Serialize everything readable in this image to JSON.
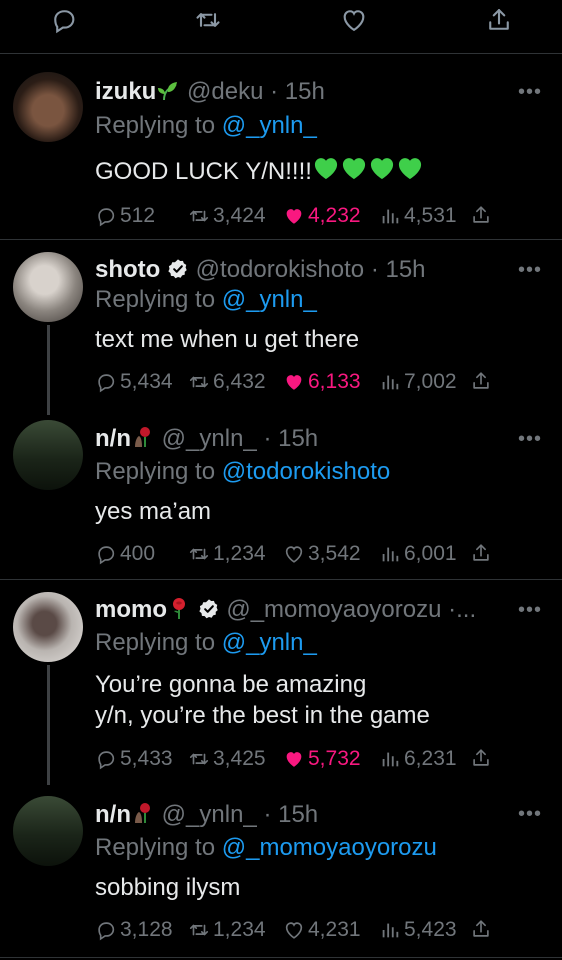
{
  "colors": {
    "background": "#000000",
    "text": "#e7e9ea",
    "muted": "#71767b",
    "link": "#1d9bf0",
    "like": "#f91880",
    "heart_emoji": "#3fcf4a",
    "rose": "#d5202e"
  },
  "top_actions": [
    "reply-icon",
    "retweet-icon",
    "like-icon",
    "share-icon"
  ],
  "tweets": [
    {
      "name": "izuku",
      "name_emoji": "seedling",
      "verified": false,
      "handle": "@deku",
      "time": "· 15h",
      "replying_prefix": "Replying to ",
      "replying_to": "@_ynln_",
      "text": "GOOD LUCK Y/N!!!!",
      "text_emoji": "green-hearts-x4",
      "replies": "512",
      "retweets": "3,424",
      "likes": "4,232",
      "liked": true,
      "views": "4,531"
    },
    {
      "name": "shoto",
      "verified": true,
      "handle": "@todorokishoto",
      "time": "· 15h",
      "replying_prefix": "Replying to ",
      "replying_to": "@_ynln_",
      "text": "text me when u get there",
      "replies": "5,434",
      "retweets": "6,432",
      "likes": "6,133",
      "liked": true,
      "views": "7,002"
    },
    {
      "name": "n/n",
      "name_emoji": "rose-figure",
      "verified": false,
      "handle": "@_ynln_",
      "time": "· 15h",
      "replying_prefix": "Replying to ",
      "replying_to": "@todorokishoto",
      "text": "yes ma’am",
      "replies": "400",
      "retweets": "1,234",
      "likes": "3,542",
      "liked": false,
      "views": "6,001"
    },
    {
      "name": "momo",
      "name_emoji": "rose",
      "verified": true,
      "handle": "@_momoyaoyorozu ·...",
      "time": "",
      "replying_prefix": "Replying to ",
      "replying_to": "@_ynln_",
      "text": "You’re gonna be amazing\ny/n, you’re the best in the game",
      "replies": "5,433",
      "retweets": "3,425",
      "likes": "5,732",
      "liked": true,
      "views": "6,231"
    },
    {
      "name": "n/n",
      "name_emoji": "rose-figure",
      "verified": false,
      "handle": "@_ynln_",
      "time": "· 15h",
      "replying_prefix": "Replying to ",
      "replying_to": "@_momoyaoyorozu",
      "text": "sobbing ilysm",
      "replies": "3,128",
      "retweets": "1,234",
      "likes": "4,231",
      "liked": false,
      "views": "5,423"
    }
  ],
  "more_glyph": "•••"
}
